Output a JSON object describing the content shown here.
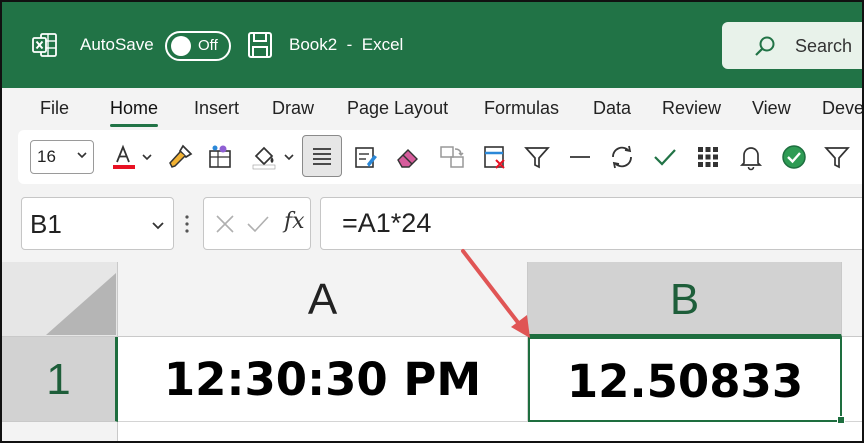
{
  "title_bar": {
    "autosave_label": "AutoSave",
    "autosave_state": "Off",
    "document_title": "Book2  -  Excel",
    "search_label": "Search"
  },
  "ribbon_tabs": [
    "File",
    "Home",
    "Insert",
    "Draw",
    "Page Layout",
    "Formulas",
    "Data",
    "Review",
    "View",
    "Deve"
  ],
  "active_tab": "Home",
  "toolbar": {
    "font_size": "16",
    "font_color": "#e81123",
    "icons": [
      "font-color-icon",
      "format-painter-icon",
      "cell-styles-icon",
      "fill-color-icon",
      "align-left-icon",
      "paste-format-icon",
      "clear-icon",
      "replace-icon",
      "delete-cells-icon",
      "filter-icon",
      "line-icon",
      "refresh-icon",
      "checkmark-icon",
      "grid-icon",
      "bell-icon",
      "approve-icon",
      "filter-icon"
    ]
  },
  "formula_bar": {
    "name_box": "B1",
    "formula": "=A1*24",
    "fx_label": "fx"
  },
  "grid": {
    "columns": [
      "A",
      "B"
    ],
    "rows": [
      "1"
    ],
    "cells": {
      "A1": "12:30:30 PM",
      "B1": "12.50833"
    },
    "selected_cell": "B1"
  },
  "colors": {
    "excel_green": "#217346",
    "selection_green": "#1e6e3f",
    "annotation_arrow": "#e05555"
  }
}
